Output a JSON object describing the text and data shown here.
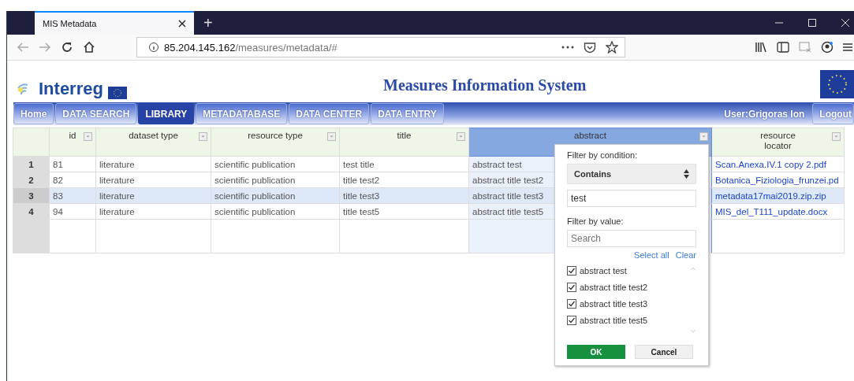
{
  "browser": {
    "tab_title": "MIS Metadata",
    "new_tab": "+",
    "url_host": "85.204.145.162",
    "url_path": "/measures/metadata/#"
  },
  "header": {
    "logo": "Interreg",
    "title": "Measures Information System"
  },
  "nav": {
    "items": [
      {
        "label": "Home",
        "selected": false
      },
      {
        "label": "DATA SEARCH",
        "selected": false
      },
      {
        "label": "LIBRARY",
        "selected": true
      },
      {
        "label": "METADATABASE",
        "selected": false
      },
      {
        "label": "DATA CENTER",
        "selected": false
      },
      {
        "label": "DATA ENTRY",
        "selected": false
      }
    ],
    "user": "User:Grigoras Ion",
    "logout": "Logout"
  },
  "table": {
    "columns": [
      {
        "label": "id",
        "selected": false
      },
      {
        "label": "dataset type",
        "selected": false
      },
      {
        "label": "resource type",
        "selected": false
      },
      {
        "label": "title",
        "selected": false
      },
      {
        "label": "abstract",
        "selected": true
      },
      {
        "label": "resource locator",
        "selected": false
      }
    ],
    "rows": [
      {
        "number": "1",
        "selected": false,
        "cells": [
          "81",
          "literature",
          "scientific publication",
          "test title",
          "abstract test",
          "Scan.Anexa.IV.1 copy 2.pdf"
        ]
      },
      {
        "number": "2",
        "selected": false,
        "cells": [
          "82",
          "literature",
          "scientific publication",
          "title test2",
          "abstract title test2",
          "Botanica_Fiziologia_frunzei.pd"
        ]
      },
      {
        "number": "3",
        "selected": true,
        "cells": [
          "83",
          "literature",
          "scientific publication",
          "title test3",
          "abstract title test3",
          "metadata17mai2019.zip.zip"
        ]
      },
      {
        "number": "4",
        "selected": false,
        "cells": [
          "94",
          "literature",
          "scientific publication",
          "title test5",
          "abstract title test5",
          "MIS_del_T111_update.docx"
        ]
      }
    ]
  },
  "filter_menu": {
    "condition_label": "Filter by condition:",
    "condition": "Contains",
    "condition_value": "test",
    "value_label": "Filter by value:",
    "search_placeholder": "Search",
    "select_all": "Select all",
    "clear": "Clear",
    "options": [
      {
        "label": "abstract test",
        "checked": true
      },
      {
        "label": "abstract title test2",
        "checked": true
      },
      {
        "label": "abstract title test3",
        "checked": true
      },
      {
        "label": "abstract title test5",
        "checked": true
      }
    ],
    "ok": "OK",
    "cancel": "Cancel"
  }
}
